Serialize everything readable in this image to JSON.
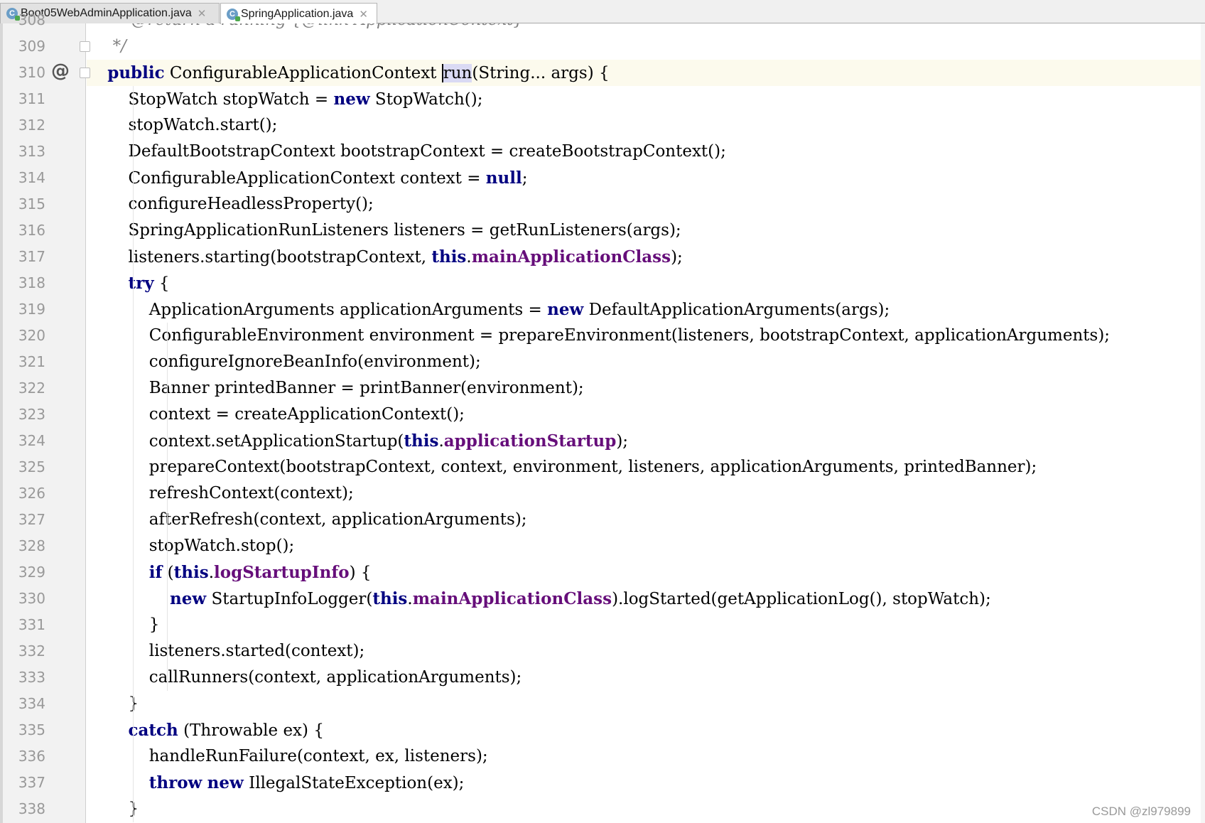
{
  "tabs": [
    {
      "label": "Boot05WebAdminApplication.java",
      "icon": "java-class-icon",
      "active": false
    },
    {
      "label": "SpringApplication.java",
      "icon": "java-class-icon",
      "active": true
    }
  ],
  "editor": {
    "current_line": 310,
    "partial_top": {
      "number": "308",
      "text": " * @return a running {@link ApplicationContext}"
    },
    "lines": [
      {
        "n": "309",
        "tokens": [
          {
            "t": "     "
          },
          {
            "t": "*/",
            "c": "cm"
          }
        ]
      },
      {
        "n": "310",
        "tokens": [
          {
            "t": "    "
          },
          {
            "t": "public",
            "c": "kw"
          },
          {
            "t": " ConfigurableApplicationContext "
          },
          {
            "t": "run",
            "c": "run"
          },
          {
            "t": "(String... args) {"
          }
        ]
      },
      {
        "n": "311",
        "tokens": [
          {
            "t": "        StopWatch stopWatch = "
          },
          {
            "t": "new",
            "c": "kw"
          },
          {
            "t": " StopWatch();"
          }
        ]
      },
      {
        "n": "312",
        "tokens": [
          {
            "t": "        stopWatch.start();"
          }
        ]
      },
      {
        "n": "313",
        "tokens": [
          {
            "t": "        DefaultBootstrapContext bootstrapContext = createBootstrapContext();"
          }
        ]
      },
      {
        "n": "314",
        "tokens": [
          {
            "t": "        ConfigurableApplicationContext context = "
          },
          {
            "t": "null",
            "c": "kw"
          },
          {
            "t": ";"
          }
        ]
      },
      {
        "n": "315",
        "tokens": [
          {
            "t": "        configureHeadlessProperty();"
          }
        ]
      },
      {
        "n": "316",
        "tokens": [
          {
            "t": "        SpringApplicationRunListeners listeners = getRunListeners(args);"
          }
        ]
      },
      {
        "n": "317",
        "tokens": [
          {
            "t": "        listeners.starting(bootstrapContext, "
          },
          {
            "t": "this",
            "c": "kw"
          },
          {
            "t": "."
          },
          {
            "t": "mainApplicationClass",
            "c": "fld"
          },
          {
            "t": ");"
          }
        ]
      },
      {
        "n": "318",
        "tokens": [
          {
            "t": "        "
          },
          {
            "t": "try",
            "c": "kw"
          },
          {
            "t": " {"
          }
        ]
      },
      {
        "n": "319",
        "tokens": [
          {
            "t": "            ApplicationArguments applicationArguments = "
          },
          {
            "t": "new",
            "c": "kw"
          },
          {
            "t": " DefaultApplicationArguments(args);"
          }
        ]
      },
      {
        "n": "320",
        "tokens": [
          {
            "t": "            ConfigurableEnvironment environment = prepareEnvironment(listeners, bootstrapContext, applicationArguments);"
          }
        ]
      },
      {
        "n": "321",
        "tokens": [
          {
            "t": "            configureIgnoreBeanInfo(environment);"
          }
        ]
      },
      {
        "n": "322",
        "tokens": [
          {
            "t": "            Banner printedBanner = printBanner(environment);"
          }
        ]
      },
      {
        "n": "323",
        "tokens": [
          {
            "t": "            context = createApplicationContext();"
          }
        ]
      },
      {
        "n": "324",
        "tokens": [
          {
            "t": "            context.setApplicationStartup("
          },
          {
            "t": "this",
            "c": "kw"
          },
          {
            "t": "."
          },
          {
            "t": "applicationStartup",
            "c": "fld"
          },
          {
            "t": ");"
          }
        ]
      },
      {
        "n": "325",
        "tokens": [
          {
            "t": "            prepareContext(bootstrapContext, context, environment, listeners, applicationArguments, printedBanner);"
          }
        ]
      },
      {
        "n": "326",
        "tokens": [
          {
            "t": "            refreshContext(context);"
          }
        ]
      },
      {
        "n": "327",
        "tokens": [
          {
            "t": "            afterRefresh(context, applicationArguments);"
          }
        ]
      },
      {
        "n": "328",
        "tokens": [
          {
            "t": "            stopWatch.stop();"
          }
        ]
      },
      {
        "n": "329",
        "tokens": [
          {
            "t": "            "
          },
          {
            "t": "if",
            "c": "kw"
          },
          {
            "t": " ("
          },
          {
            "t": "this",
            "c": "kw"
          },
          {
            "t": "."
          },
          {
            "t": "logStartupInfo",
            "c": "fld"
          },
          {
            "t": ") {"
          }
        ]
      },
      {
        "n": "330",
        "tokens": [
          {
            "t": "                "
          },
          {
            "t": "new",
            "c": "kw"
          },
          {
            "t": " StartupInfoLogger("
          },
          {
            "t": "this",
            "c": "kw"
          },
          {
            "t": "."
          },
          {
            "t": "mainApplicationClass",
            "c": "fld"
          },
          {
            "t": ").logStarted(getApplicationLog(), stopWatch);"
          }
        ]
      },
      {
        "n": "331",
        "tokens": [
          {
            "t": "            }"
          }
        ]
      },
      {
        "n": "332",
        "tokens": [
          {
            "t": "            listeners.started(context);"
          }
        ]
      },
      {
        "n": "333",
        "tokens": [
          {
            "t": "            callRunners(context, applicationArguments);"
          }
        ]
      },
      {
        "n": "334",
        "tokens": [
          {
            "t": "        }"
          }
        ]
      },
      {
        "n": "335",
        "tokens": [
          {
            "t": "        "
          },
          {
            "t": "catch",
            "c": "kw"
          },
          {
            "t": " (Throwable ex) {"
          }
        ]
      },
      {
        "n": "336",
        "tokens": [
          {
            "t": "            handleRunFailure(context, ex, listeners);"
          }
        ]
      },
      {
        "n": "337",
        "tokens": [
          {
            "t": "            "
          },
          {
            "t": "throw",
            "c": "kw"
          },
          {
            "t": " "
          },
          {
            "t": "new",
            "c": "kw"
          },
          {
            "t": " IllegalStateException(ex);"
          }
        ]
      },
      {
        "n": "338",
        "tokens": [
          {
            "t": "        }"
          }
        ]
      }
    ],
    "override_marker": "@"
  },
  "watermark": "CSDN @zl979899",
  "colors": {
    "keyword": "#000080",
    "field": "#660e7a",
    "comment": "#808080",
    "current_line_bg": "#fcfaed",
    "highlight_bg": "#dadaf4"
  }
}
